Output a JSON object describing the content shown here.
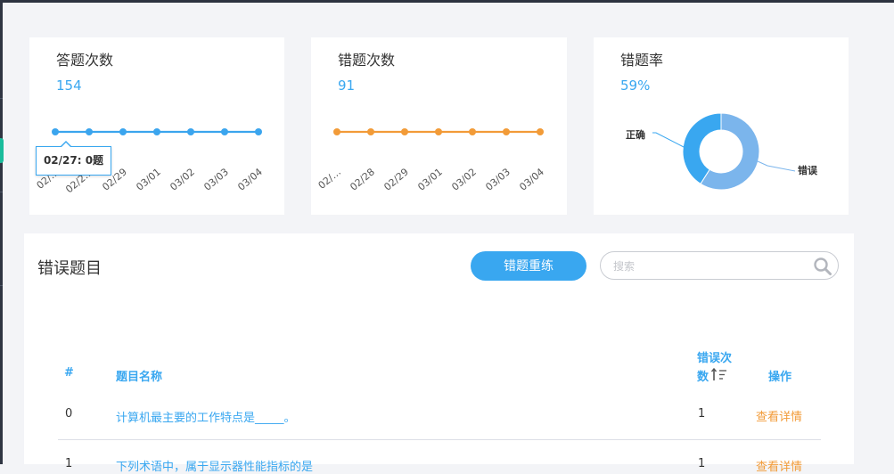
{
  "stats": [
    {
      "title": "答题次数",
      "value": "154"
    },
    {
      "title": "错题次数",
      "value": "91"
    },
    {
      "title": "错题率",
      "value": "59%"
    }
  ],
  "chart_data": [
    {
      "type": "line",
      "x": [
        "02/27",
        "02/28",
        "02/29",
        "03/01",
        "03/02",
        "03/03",
        "03/04"
      ],
      "tick_labels": [
        "02/…",
        "02/2…",
        "02/29",
        "03/01",
        "03/02",
        "03/03",
        "03/04"
      ],
      "values": [
        0,
        0,
        0,
        0,
        0,
        0,
        0
      ],
      "color": "#3ba5ee",
      "tooltip": "02/27: 0题"
    },
    {
      "type": "line",
      "x": [
        "02/27",
        "02/28",
        "02/29",
        "03/01",
        "03/02",
        "03/03",
        "03/04"
      ],
      "tick_labels": [
        "02/…",
        "02/28",
        "02/29",
        "03/01",
        "03/02",
        "03/03",
        "03/04"
      ],
      "values": [
        0,
        0,
        0,
        0,
        0,
        0,
        0
      ],
      "color": "#f29b38"
    },
    {
      "type": "pie",
      "categories": [
        "错误",
        "正确"
      ],
      "values": [
        59,
        41
      ],
      "colors": [
        "#7bb5ec",
        "#39a7f0"
      ]
    }
  ],
  "wrong_questions": {
    "title": "错误题目",
    "retrain_label": "错题重练",
    "search_placeholder": "搜索",
    "columns": {
      "index": "#",
      "name": "题目名称",
      "count_line1": "错误次",
      "count_line2": "数",
      "action": "操作"
    },
    "rows": [
      {
        "index": "0",
        "name": "计算机最主要的工作特点是_____。",
        "count": "1",
        "action": "查看详情"
      },
      {
        "index": "1",
        "name": "下列术语中，属于显示器性能指标的是",
        "count": "1",
        "action": "查看详情"
      }
    ]
  }
}
